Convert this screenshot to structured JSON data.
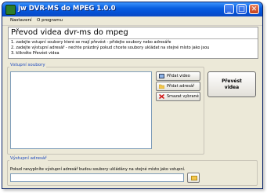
{
  "window": {
    "title": "jw DVR-MS do MPEG 1.0.0",
    "accent": "#0a5fe0"
  },
  "titlebar": {
    "minimize_glyph": "_",
    "maximize_glyph": "□",
    "close_glyph": "✕"
  },
  "menu": {
    "items": [
      "Nastavení",
      "O programu"
    ]
  },
  "header": {
    "title": "Převod videa dvr-ms do mpeg",
    "steps": [
      "1. zadejte vstupní soubory které se mají převést - přidejte soubory nebo adresáře",
      "2. zadejte výstupní adresář - nechte prázdný pokud chcete soubory ukládat na stejné místo jako jsou",
      "3. klikněte Převést videa"
    ]
  },
  "input_group": {
    "label": "Vstupní soubory"
  },
  "buttons": {
    "add_video": "Přidat video",
    "add_folder": "Přidat adresář",
    "remove_selected": "Smazat vybrané",
    "convert_line1": "Převést",
    "convert_line2": "videa"
  },
  "output_group": {
    "label": "Výstupní adresář",
    "note": "Pokud nevyplníte výstupní adresář budou soubory ukládány na stejné místo jako vstupní.",
    "value": ""
  },
  "icons": {
    "add_video": "film-icon",
    "add_folder": "folder-icon",
    "remove": "red-x-icon",
    "browse": "folder-icon"
  }
}
